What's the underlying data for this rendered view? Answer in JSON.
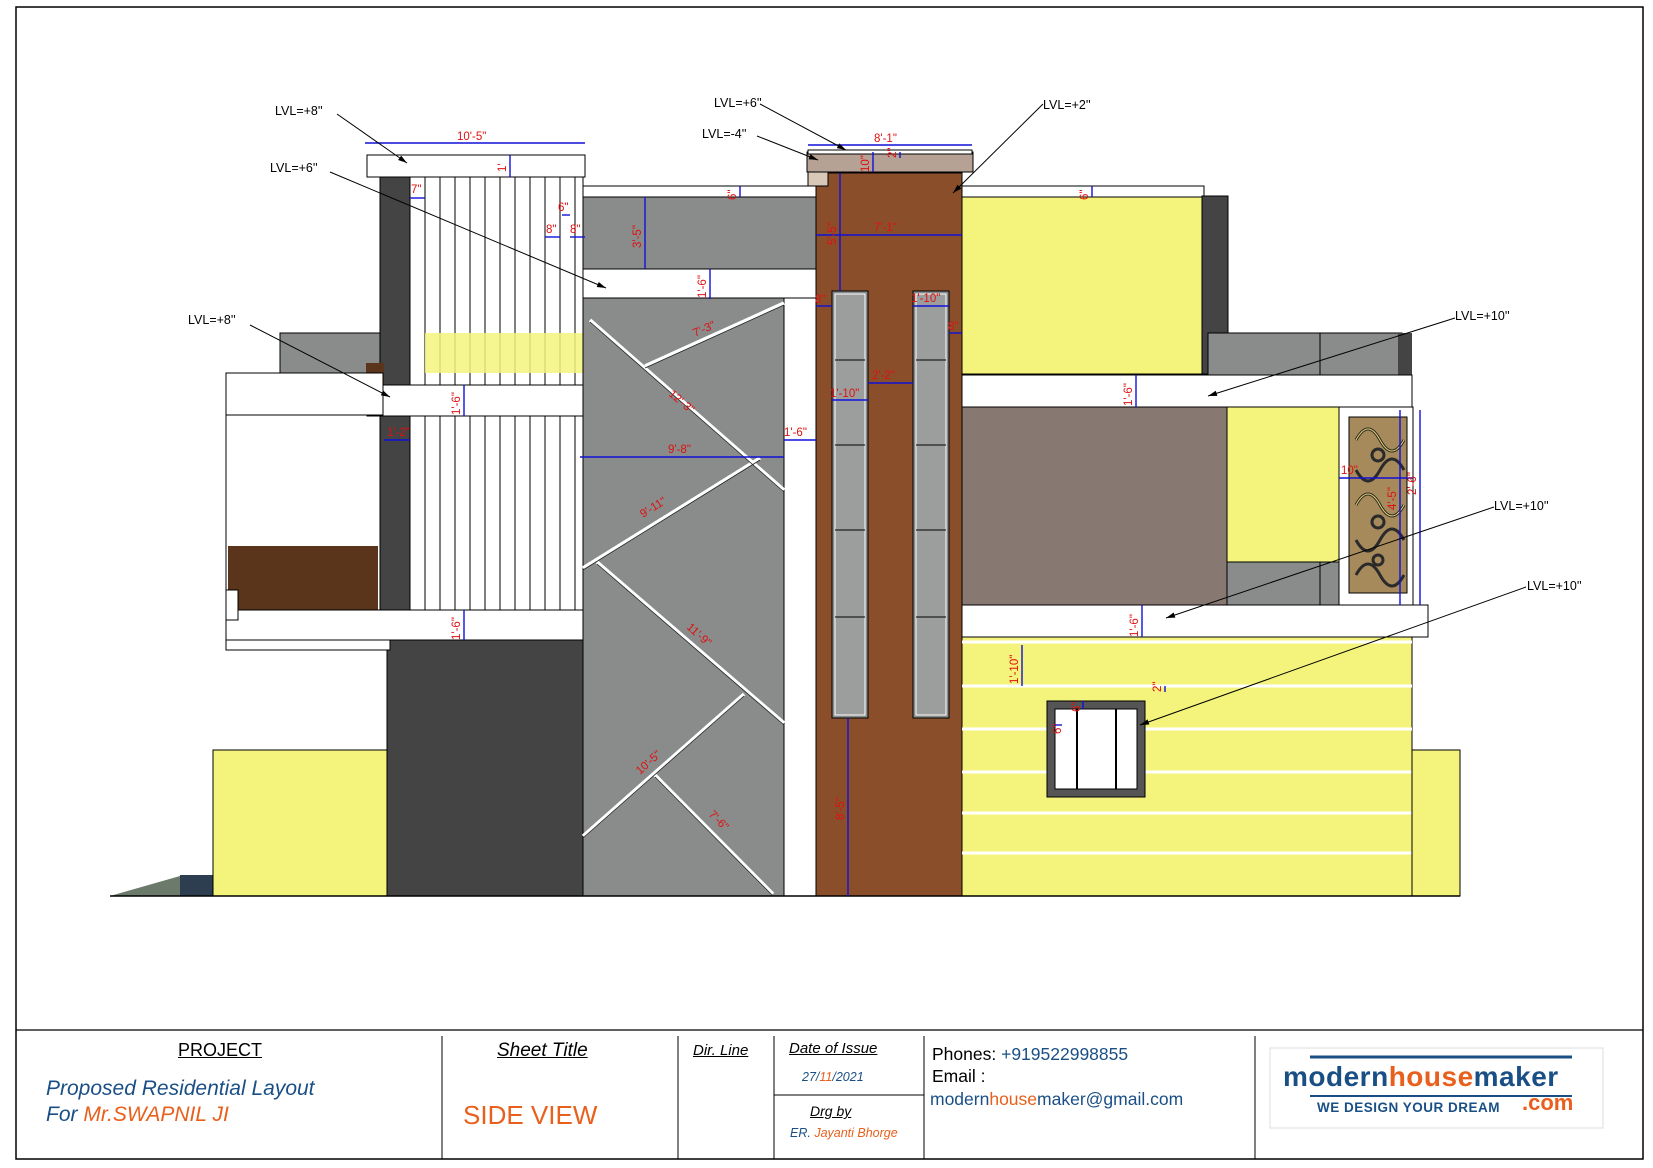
{
  "drawing": {
    "level_labels": [
      "LVL=+8''",
      "LVL=+6''",
      "LVL=+8''",
      "LVL=+6''",
      "LVL=-4''",
      "LVL=+2''",
      "LVL=+10''",
      "LVL=+10''",
      "LVL=+10''"
    ],
    "dimensions": [
      "10'-5\"",
      "1'",
      "7\"",
      "6\"",
      "8\"",
      "8\"",
      "6\"",
      "3'-5\"",
      "1'-6\"",
      "7'-3\"",
      "12'-3\"",
      "9'-8\"",
      "9'-11\"",
      "11'-9\"",
      "10'-5\"",
      "7'-6\"",
      "1'-6\"",
      "1'-6\"",
      "1'-6\"",
      "1'-2\"",
      "8'-1\"",
      "10\"",
      "2\"",
      "5'-5\"",
      "7'-1\"",
      "1'-10\"",
      "8\"",
      "2'-2\"",
      "1'-10\"",
      "8\"",
      "6\"",
      "8'-5\"",
      "1'-6\"",
      "1'-6\"",
      "1'-10\"",
      "2\"",
      "6\"",
      "6\"",
      "10\"",
      "4'-5\"",
      "2'-6\""
    ]
  },
  "title_block": {
    "project_heading": "PROJECT",
    "project_line1": "Proposed Residential Layout",
    "project_for": "For ",
    "project_client": "Mr.SWAPNIL JI",
    "sheet_title_heading": "Sheet Title",
    "sheet_title_value": "SIDE VIEW",
    "dir_line_heading": "Dir. Line",
    "date_heading": "Date of Issue",
    "date_day": "27/",
    "date_month": "11",
    "date_year": "/2021",
    "drg_heading": "Drg by",
    "drg_prefix": "ER. ",
    "drg_name": "Jayanti Bhorge",
    "phones_label": "Phones:",
    "phones_value": "+919522998855",
    "email_label": "Email :",
    "email_part1": "modern",
    "email_part2": "house",
    "email_part3": "maker",
    "email_part4": "@gmail.com",
    "logo_modern": "modern",
    "logo_house": "house",
    "logo_maker": "maker",
    "logo_tagline": "WE DESIGN YOUR DREAM",
    "logo_com": ".com"
  },
  "colors": {
    "yellow": "#f4f47c",
    "brown": "#8a4f2a",
    "gray": "#8a8c8b",
    "dark": "#444444",
    "taupe": "#877972",
    "dim_text": "#e01010",
    "dim_line": "#1010d8",
    "title_blue": "#1a4f86",
    "title_orange": "#e8601c"
  }
}
